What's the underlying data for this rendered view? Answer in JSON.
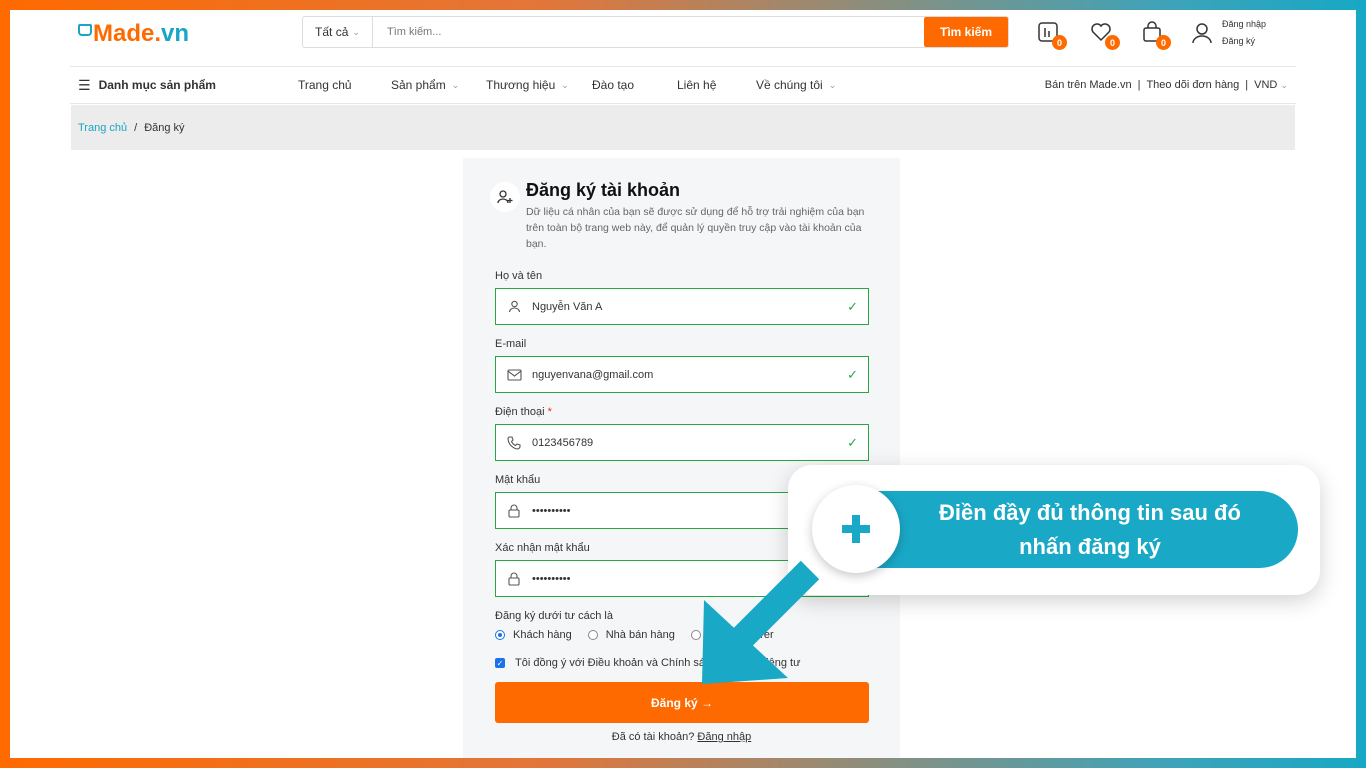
{
  "header": {
    "logo": {
      "part1": "Made",
      "dot": ".",
      "part2": "vn"
    },
    "search": {
      "category": "Tất cả",
      "placeholder": "Tìm kiếm...",
      "button": "Tìm kiếm"
    },
    "compare_count": "0",
    "wishlist_count": "0",
    "cart_count": "0",
    "account": {
      "login": "Đăng nhập",
      "register": "Đăng ký"
    }
  },
  "nav": {
    "categories": "Danh mục sản phẩm",
    "links": [
      "Trang chủ",
      "Sản phẩm",
      "Thương hiệu",
      "Đào tạo",
      "Liên hệ",
      "Về chúng tôi"
    ],
    "right": {
      "sell": "Bán trên Made.vn",
      "sep1": "|",
      "track": "Theo dõi đơn hàng",
      "sep2": "|",
      "currency": "VND"
    }
  },
  "breadcrumb": {
    "home": "Trang chủ",
    "sep": "/",
    "current": "Đăng ký"
  },
  "form": {
    "title": "Đăng ký tài khoản",
    "description": "Dữ liệu cá nhân của bạn sẽ được sử dụng để hỗ trợ trải nghiệm của bạn trên toàn bộ trang web này, để quản lý quyền truy cập vào tài khoản của bạn.",
    "fields": {
      "name": {
        "label": "Họ và tên",
        "value": "Nguyễn Văn A"
      },
      "email": {
        "label": "E-mail",
        "value": "nguyenvana@gmail.com"
      },
      "phone": {
        "label": "Điện thoại",
        "required": "*",
        "value": "0123456789"
      },
      "password": {
        "label": "Mật khẩu",
        "value": "••••••••••"
      },
      "confirm": {
        "label": "Xác nhận mật khẩu",
        "value": "••••••••••"
      }
    },
    "role_label": "Đăng ký dưới tư cách là",
    "roles": [
      "Khách hàng",
      "Nhà bán hàng",
      "Manufacturer"
    ],
    "agree_text": "Tôi đồng ý với Điều khoản và Chính sách bảo mật riêng tư",
    "submit": "Đăng ký →",
    "login_prompt": "Đã có tài khoản?",
    "login_link": "Đăng nhập"
  },
  "callout": {
    "line1": "Điền đầy đủ thông tin sau đó",
    "line2": "nhấn đăng ký"
  },
  "colors": {
    "brand_orange": "#ff6a00",
    "brand_teal": "#19a8c6",
    "valid_green": "#28a745"
  }
}
